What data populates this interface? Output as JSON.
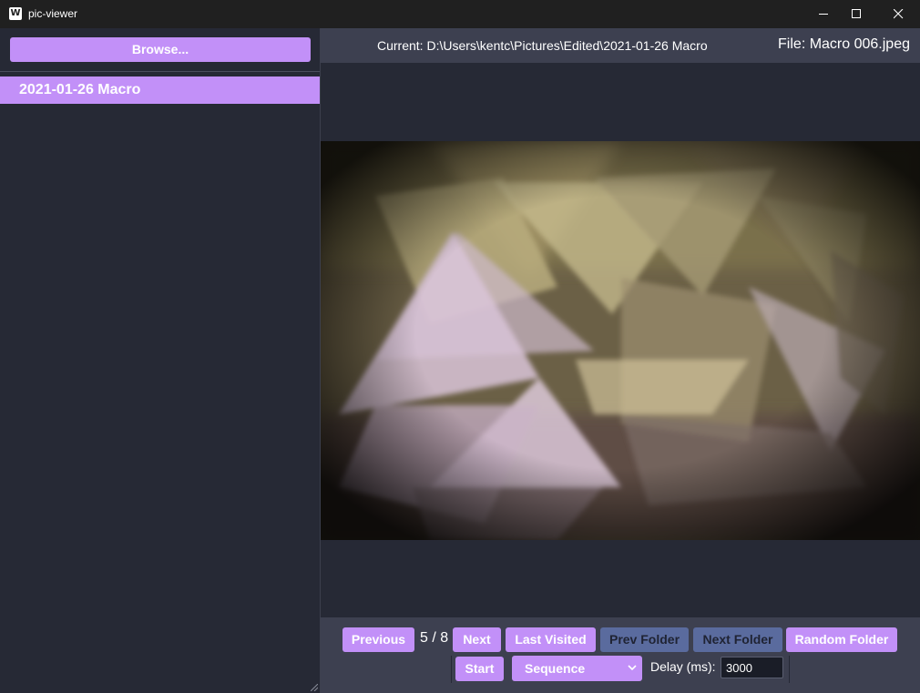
{
  "window": {
    "title": "pic-viewer",
    "icon_letter": "W"
  },
  "sidebar": {
    "browse_label": "Browse...",
    "folders": [
      {
        "label": "2021-01-26 Macro",
        "selected": true
      }
    ]
  },
  "header": {
    "current_path": "Current: D:\\Users\\kentc\\Pictures\\Edited\\2021-01-26 Macro",
    "file_label": "File: Macro 006.jpeg"
  },
  "controls": {
    "previous_label": "Previous",
    "counter": "5 / 8",
    "next_label": "Next",
    "last_visited_label": "Last Visited",
    "prev_folder_label": "Prev Folder",
    "next_folder_label": "Next Folder",
    "random_folder_label": "Random Folder",
    "start_label": "Start",
    "mode_selected": "Sequence",
    "delay_label": "Delay (ms):",
    "delay_value": "3000"
  },
  "colors": {
    "accent": "#c290f8",
    "muted_button": "#5a6b9e",
    "panel": "#3d4050",
    "background": "#262935"
  }
}
